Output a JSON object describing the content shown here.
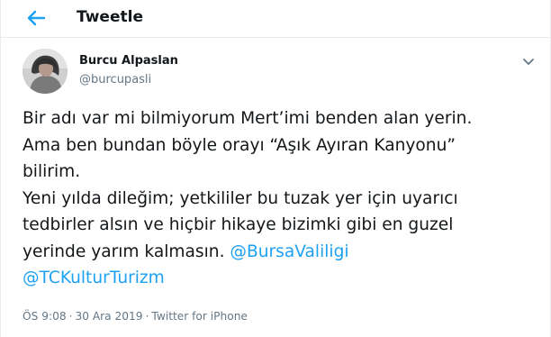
{
  "header": {
    "title": "Tweetle"
  },
  "tweet": {
    "author_name": "Burcu Alpaslan",
    "author_handle": "@burcupasli",
    "text_lines": [
      "Bir adı var mi bilmiyorum Mert’imi benden alan yerin.",
      "Ama ben bundan böyle orayı “Aşık Ayıran Kanyonu”",
      "bilirim.",
      "Yeni yılda dileğim; yetkililer bu tuzak yer için uyarıcı",
      "tedbirler alsın ve hiçbir hikaye bizimki gibi en guzel",
      "yerinde yarım kalmasın."
    ],
    "mentions": [
      "@BursaValiligi",
      "@TCKulturTurizm"
    ],
    "time": "ÖS 9:08",
    "separator": "·",
    "date": "30 Ara 2019",
    "source": "Twitter for iPhone"
  },
  "icons": {
    "back": "back-arrow-icon",
    "caret": "chevron-down-icon"
  },
  "colors": {
    "accent": "#1da1f2",
    "text": "#14171a",
    "muted": "#657786",
    "border": "#e6ecf0"
  }
}
